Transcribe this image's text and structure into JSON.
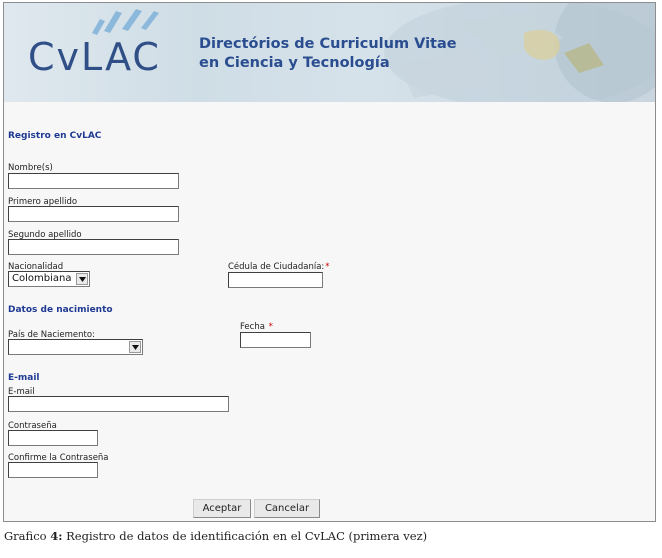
{
  "banner": {
    "logo_text": "CvLAC",
    "title_line1": "Directórios de Curriculum Vitae",
    "title_line2": "en Ciencia y Tecnología"
  },
  "form": {
    "section_registro": "Registro en CvLAC",
    "nombres_label": "Nombre(s)",
    "nombres_value": "",
    "primer_apellido_label": "Primero apellido",
    "primer_apellido_value": "",
    "segundo_apellido_label": "Segundo apellido",
    "segundo_apellido_value": "",
    "nacionalidad_label": "Nacionalidad",
    "nacionalidad_selected": "Colombiana",
    "cedula_label": "Cédula de Ciudadanía:",
    "cedula_value": "",
    "required_mark": "*",
    "section_nacimiento": "Datos de nacimiento",
    "pais_label": "País de Naciemento:",
    "pais_selected": "",
    "fecha_label": "Fecha",
    "fecha_value": "",
    "section_email": "E-mail",
    "email_label": "E-mail",
    "email_value": "",
    "contrasena_label": "Contraseña",
    "contrasena_value": "",
    "confirme_label": "Confirme la Contraseña",
    "confirme_value": ""
  },
  "buttons": {
    "accept": "Aceptar",
    "cancel": "Cancelar"
  },
  "caption": {
    "prefix": "Grafico",
    "number": "4:",
    "text": "Registro de datos de identificación en el CvLAC (primera vez)"
  },
  "colors": {
    "accent_blue": "#1f3a93",
    "required_red": "#cc0000"
  },
  "icons": [
    "dropdown-arrow-icon",
    "dropdown-arrow-icon"
  ]
}
